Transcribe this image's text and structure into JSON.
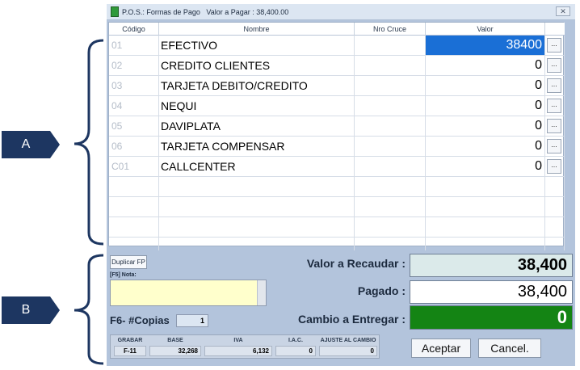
{
  "window": {
    "title": "P.O.S.: Formas de Pago",
    "amount_label": "Valor a Pagar : 38,400.00",
    "close_glyph": "✕"
  },
  "annotations": {
    "a": "A",
    "b": "B"
  },
  "grid": {
    "headers": {
      "codigo": "Código",
      "nombre": "Nombre",
      "cruce": "Nro Cruce",
      "valor": "Valor"
    },
    "rows": [
      {
        "code": "01",
        "name": "EFECTIVO",
        "value": "38400"
      },
      {
        "code": "02",
        "name": "CREDITO CLIENTES",
        "value": "0"
      },
      {
        "code": "03",
        "name": "TARJETA DEBITO/CREDITO",
        "value": "0"
      },
      {
        "code": "04",
        "name": "NEQUI",
        "value": "0"
      },
      {
        "code": "05",
        "name": "DAVIPLATA",
        "value": "0"
      },
      {
        "code": "06",
        "name": "TARJETA COMPENSAR",
        "value": "0"
      },
      {
        "code": "C01",
        "name": "CALLCENTER",
        "value": "0"
      }
    ],
    "dots_label": "..."
  },
  "footer": {
    "duplicate_label": "Duplicar FP",
    "nota_label": "[F5] Nota:",
    "nota_value": "",
    "copias_label": "F6- #Copias",
    "copias_value": "1",
    "recaudar_label": "Valor a Recaudar :",
    "recaudar_value": "38,400",
    "pagado_label": "Pagado :",
    "pagado_value": "38,400",
    "cambio_label": "Cambio a Entregar :",
    "cambio_value": "0",
    "summary": {
      "grabar_label": "GRABAR",
      "grabar_value": "F-11",
      "base_label": "BASE",
      "base_value": "32,268",
      "iva_label": "IVA",
      "iva_value": "6,132",
      "iac_label": "I.A.C.",
      "iac_value": "0",
      "ajuste_label": "AJUSTE AL CAMBIO",
      "ajuste_value": "0"
    },
    "accept_label": "Aceptar",
    "cancel_label": "Cancel."
  },
  "colors": {
    "selected": "#1a6fd6",
    "cambio_bg": "#148414",
    "recaudar_bg": "#dbeaea",
    "marker": "#1d3661"
  }
}
